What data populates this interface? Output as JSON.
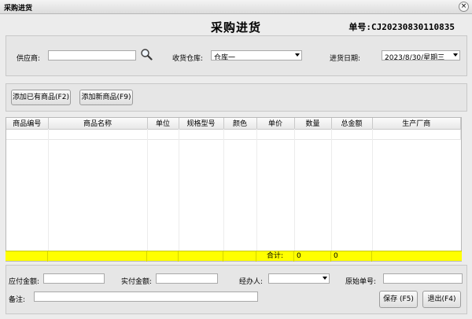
{
  "window": {
    "title": "采购进货",
    "close_glyph": "×"
  },
  "form": {
    "title": "采购进货",
    "order_no": "单号:CJ20230830110835"
  },
  "header": {
    "supplier_label": "供应商:",
    "supplier_value": "",
    "warehouse_label": "收货仓库:",
    "warehouse_value": "仓库一",
    "date_label": "进货日期:",
    "date_value": "2023/8/30/星期三"
  },
  "toolbar": {
    "add_existing": "添加已有商品(F2)",
    "add_new": "添加新商品(F9)"
  },
  "grid": {
    "columns": [
      "商品编号",
      "商品名称",
      "单位",
      "规格型号",
      "颜色",
      "单价",
      "数量",
      "总金额",
      "生产厂商"
    ],
    "total_label": "合计:",
    "total_qty": "0",
    "total_amount": "0"
  },
  "footer": {
    "payable_label": "应付金额:",
    "payable_value": "",
    "paid_label": "实付金额:",
    "paid_value": "",
    "handler_label": "经办人:",
    "handler_value": "",
    "original_no_label": "原始单号:",
    "original_no_value": "",
    "remark_label": "备注:",
    "remark_value": "",
    "save_button": "保存 (F5)",
    "exit_button": "退出(F4)"
  }
}
